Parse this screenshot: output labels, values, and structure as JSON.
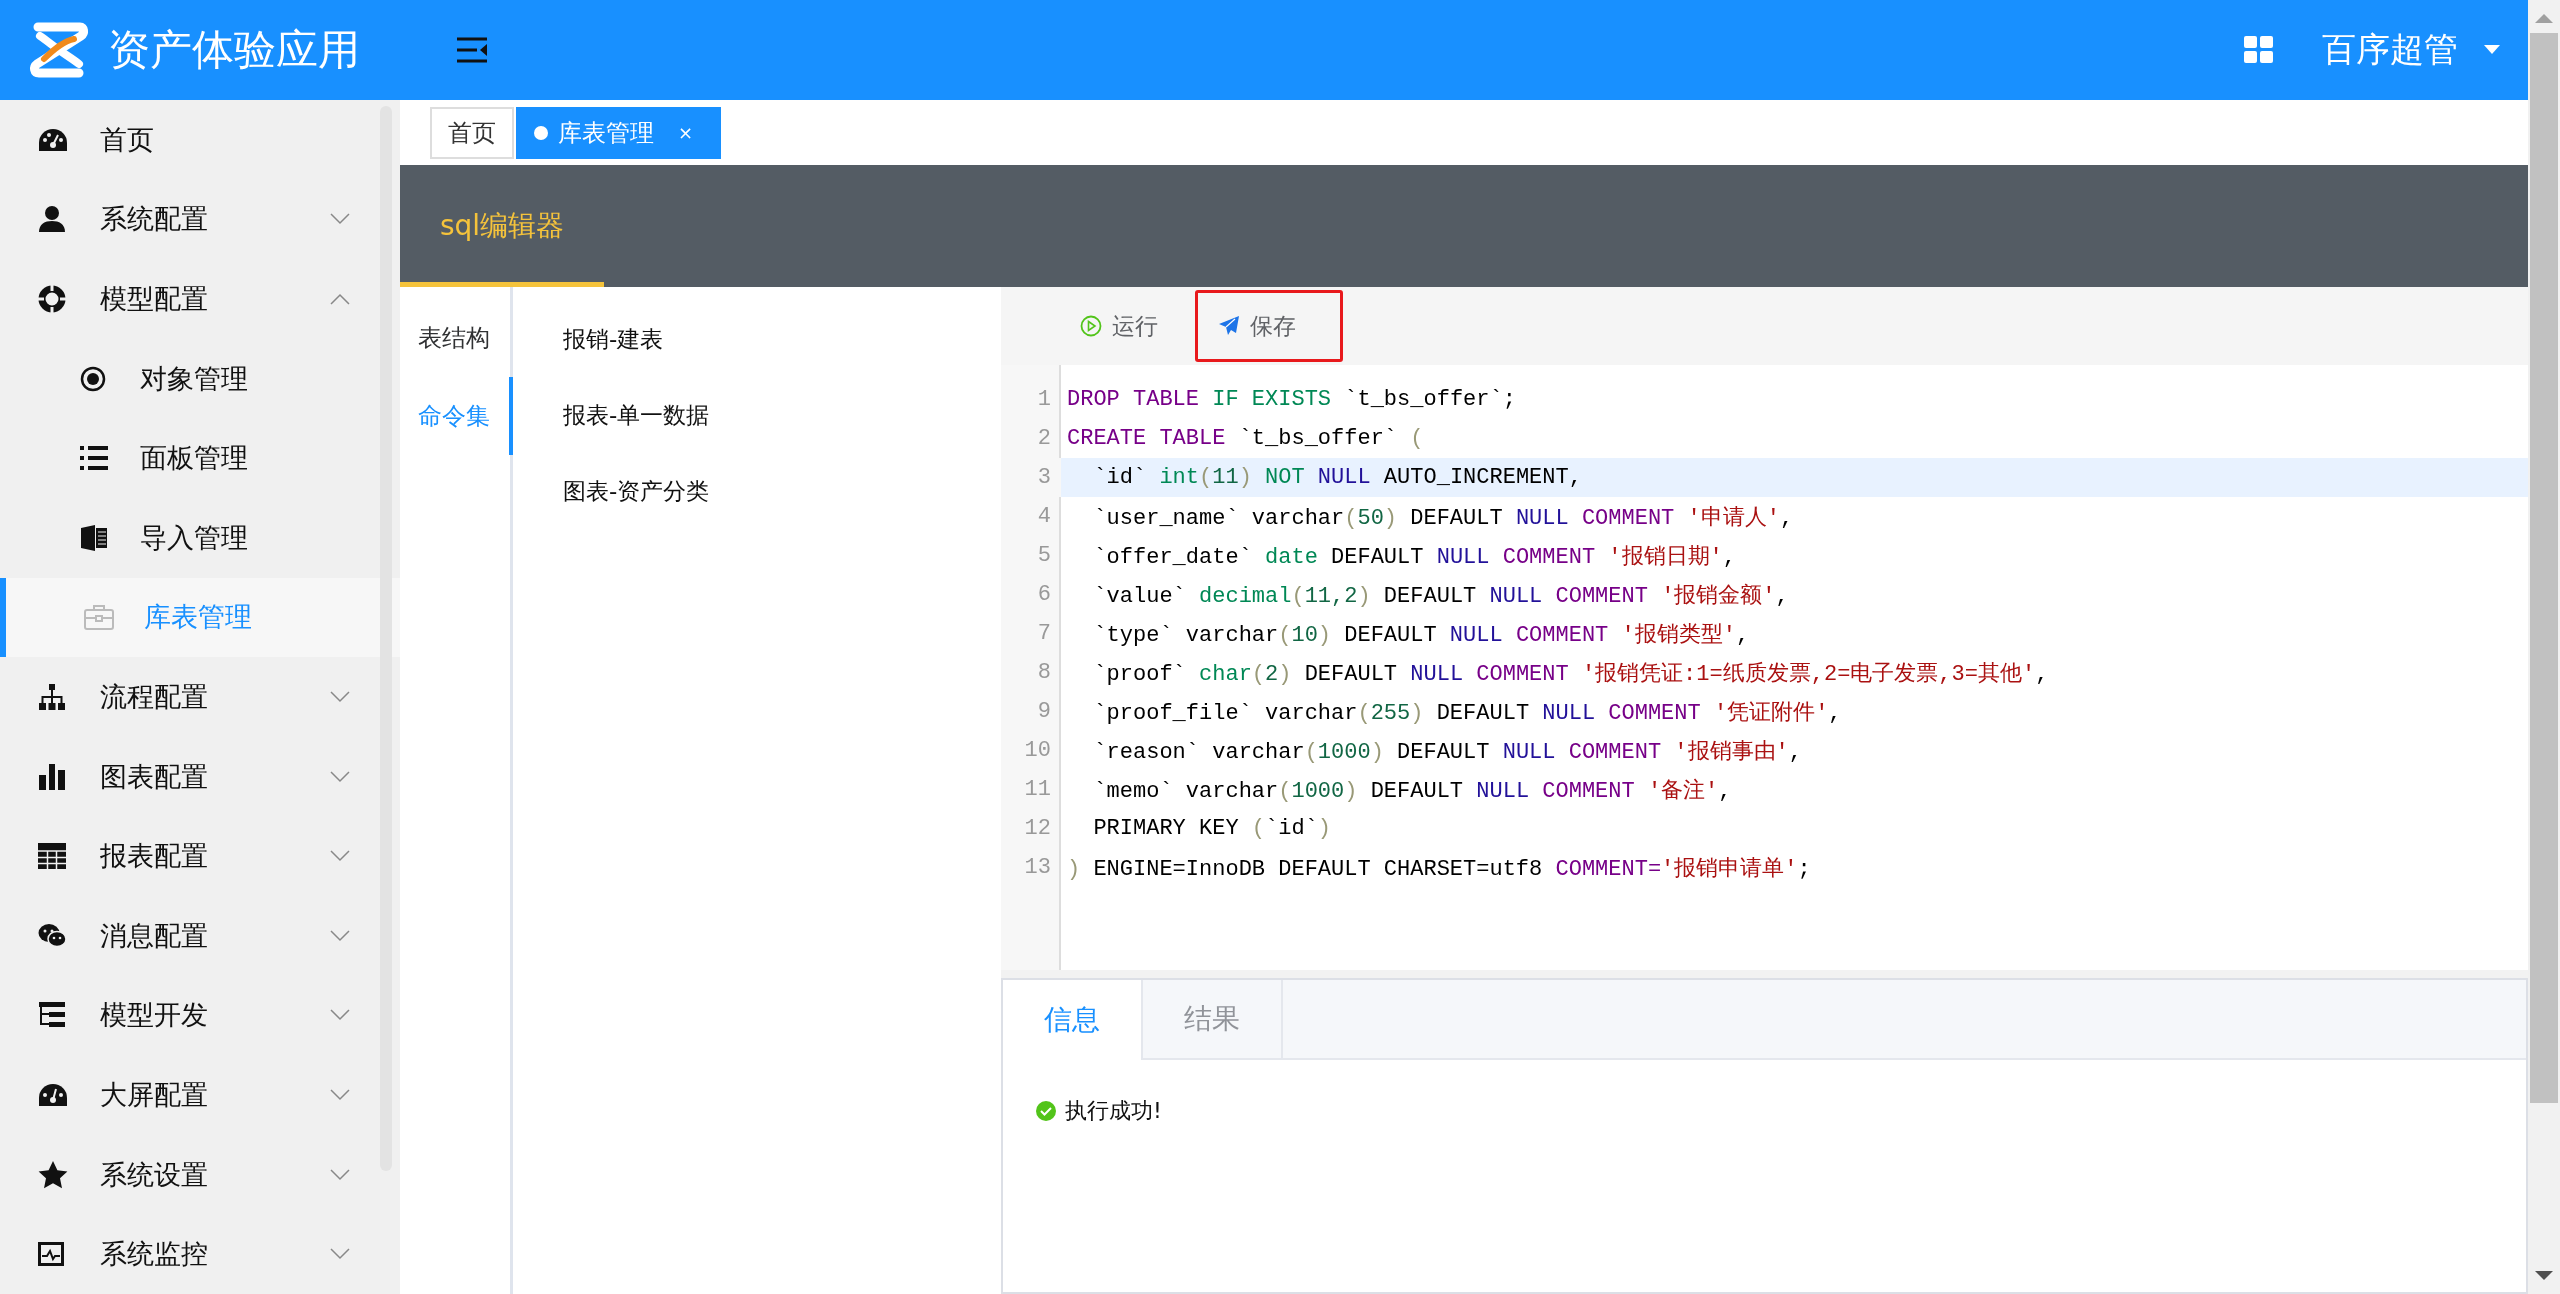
{
  "header": {
    "title": "资产体验应用",
    "user": "百序超管"
  },
  "menu": [
    {
      "label": "首页",
      "selected": false
    },
    {
      "label": "系统配置",
      "selected": false,
      "expanded": false
    },
    {
      "label": "模型配置",
      "selected": false,
      "expanded": true,
      "children": [
        {
          "label": "对象管理",
          "selected": false
        },
        {
          "label": "面板管理",
          "selected": false
        },
        {
          "label": "导入管理",
          "selected": false
        },
        {
          "label": "库表管理",
          "selected": true
        }
      ]
    },
    {
      "label": "流程配置",
      "selected": false,
      "expanded": false
    },
    {
      "label": "图表配置",
      "selected": false,
      "expanded": false
    },
    {
      "label": "报表配置",
      "selected": false,
      "expanded": false
    },
    {
      "label": "消息配置",
      "selected": false,
      "expanded": false
    },
    {
      "label": "模型开发",
      "selected": false,
      "expanded": false
    },
    {
      "label": "大屏配置",
      "selected": false,
      "expanded": false
    },
    {
      "label": "系统设置",
      "selected": false,
      "expanded": false
    },
    {
      "label": "系统监控",
      "selected": false,
      "expanded": false
    }
  ],
  "page_tabs": [
    {
      "label": "首页",
      "selected": false
    },
    {
      "label": "库表管理",
      "selected": true,
      "close": "×"
    }
  ],
  "panel_title": "sql编辑器",
  "side_tabs": [
    {
      "label": "表结构",
      "selected": false
    },
    {
      "label": "命令集",
      "selected": true
    }
  ],
  "commands": [
    "报销-建表",
    "报表-单一数据",
    "图表-资产分类"
  ],
  "toolbar": [
    {
      "label": "运行",
      "highlighted": false
    },
    {
      "label": "保存",
      "highlighted": true
    }
  ],
  "code": [
    {
      "number": "1",
      "active": false,
      "tokens": [
        {
          "kind": "keyword",
          "text": "DROP TABLE"
        },
        {
          "kind": "builtin",
          "text": " IF EXISTS"
        },
        {
          "kind": "plain",
          "text": " `t_bs_offer`;"
        }
      ]
    },
    {
      "number": "2",
      "active": false,
      "tokens": [
        {
          "kind": "keyword",
          "text": "CREATE TABLE"
        },
        {
          "kind": "plain",
          "text": " `t_bs_offer`"
        },
        {
          "kind": "bracket",
          "text": " ("
        }
      ]
    },
    {
      "number": "3",
      "active": true,
      "tokens": [
        {
          "kind": "plain",
          "text": "  `id`"
        },
        {
          "kind": "builtin",
          "text": " int"
        },
        {
          "kind": "bracket",
          "text": "("
        },
        {
          "kind": "number",
          "text": "11"
        },
        {
          "kind": "bracket",
          "text": ")"
        },
        {
          "kind": "builtin",
          "text": " NOT"
        },
        {
          "kind": "atom",
          "text": " NULL"
        },
        {
          "kind": "plain",
          "text": " AUTO_INCREMENT,"
        }
      ]
    },
    {
      "number": "4",
      "active": false,
      "tokens": [
        {
          "kind": "plain",
          "text": "  `user_name` varchar"
        },
        {
          "kind": "bracket",
          "text": "("
        },
        {
          "kind": "number",
          "text": "50"
        },
        {
          "kind": "bracket",
          "text": ")"
        },
        {
          "kind": "plain",
          "text": " DEFAULT"
        },
        {
          "kind": "atom",
          "text": " NULL"
        },
        {
          "kind": "keyword",
          "text": " COMMENT"
        },
        {
          "kind": "string",
          "text": " '申请人'"
        },
        {
          "kind": "plain",
          "text": ","
        }
      ]
    },
    {
      "number": "5",
      "active": false,
      "tokens": [
        {
          "kind": "plain",
          "text": "  `offer_date`"
        },
        {
          "kind": "builtin",
          "text": " date"
        },
        {
          "kind": "plain",
          "text": " DEFAULT"
        },
        {
          "kind": "atom",
          "text": " NULL"
        },
        {
          "kind": "keyword",
          "text": " COMMENT"
        },
        {
          "kind": "string",
          "text": " '报销日期'"
        },
        {
          "kind": "plain",
          "text": ","
        }
      ]
    },
    {
      "number": "6",
      "active": false,
      "tokens": [
        {
          "kind": "plain",
          "text": "  `value`"
        },
        {
          "kind": "builtin",
          "text": " decimal"
        },
        {
          "kind": "bracket",
          "text": "("
        },
        {
          "kind": "number",
          "text": "11,2"
        },
        {
          "kind": "bracket",
          "text": ")"
        },
        {
          "kind": "plain",
          "text": " DEFAULT"
        },
        {
          "kind": "atom",
          "text": " NULL"
        },
        {
          "kind": "keyword",
          "text": " COMMENT"
        },
        {
          "kind": "string",
          "text": " '报销金额'"
        },
        {
          "kind": "plain",
          "text": ","
        }
      ]
    },
    {
      "number": "7",
      "active": false,
      "tokens": [
        {
          "kind": "plain",
          "text": "  `type` varchar"
        },
        {
          "kind": "bracket",
          "text": "("
        },
        {
          "kind": "number",
          "text": "10"
        },
        {
          "kind": "bracket",
          "text": ")"
        },
        {
          "kind": "plain",
          "text": " DEFAULT"
        },
        {
          "kind": "atom",
          "text": " NULL"
        },
        {
          "kind": "keyword",
          "text": " COMMENT"
        },
        {
          "kind": "string",
          "text": " '报销类型'"
        },
        {
          "kind": "plain",
          "text": ","
        }
      ]
    },
    {
      "number": "8",
      "active": false,
      "tokens": [
        {
          "kind": "plain",
          "text": "  `proof`"
        },
        {
          "kind": "builtin",
          "text": " char"
        },
        {
          "kind": "bracket",
          "text": "("
        },
        {
          "kind": "number",
          "text": "2"
        },
        {
          "kind": "bracket",
          "text": ")"
        },
        {
          "kind": "plain",
          "text": " DEFAULT"
        },
        {
          "kind": "atom",
          "text": " NULL"
        },
        {
          "kind": "keyword",
          "text": " COMMENT"
        },
        {
          "kind": "string",
          "text": " '报销凭证:1=纸质发票,2=电子发票,3=其他'"
        },
        {
          "kind": "plain",
          "text": ","
        }
      ]
    },
    {
      "number": "9",
      "active": false,
      "tokens": [
        {
          "kind": "plain",
          "text": "  `proof_file` varchar"
        },
        {
          "kind": "bracket",
          "text": "("
        },
        {
          "kind": "number",
          "text": "255"
        },
        {
          "kind": "bracket",
          "text": ")"
        },
        {
          "kind": "plain",
          "text": " DEFAULT"
        },
        {
          "kind": "atom",
          "text": " NULL"
        },
        {
          "kind": "keyword",
          "text": " COMMENT"
        },
        {
          "kind": "string",
          "text": " '凭证附件'"
        },
        {
          "kind": "plain",
          "text": ","
        }
      ]
    },
    {
      "number": "10",
      "active": false,
      "tokens": [
        {
          "kind": "plain",
          "text": "  `reason` varchar"
        },
        {
          "kind": "bracket",
          "text": "("
        },
        {
          "kind": "number",
          "text": "1000"
        },
        {
          "kind": "bracket",
          "text": ")"
        },
        {
          "kind": "plain",
          "text": " DEFAULT"
        },
        {
          "kind": "atom",
          "text": " NULL"
        },
        {
          "kind": "keyword",
          "text": " COMMENT"
        },
        {
          "kind": "string",
          "text": " '报销事由'"
        },
        {
          "kind": "plain",
          "text": ","
        }
      ]
    },
    {
      "number": "11",
      "active": false,
      "tokens": [
        {
          "kind": "plain",
          "text": "  `memo` varchar"
        },
        {
          "kind": "bracket",
          "text": "("
        },
        {
          "kind": "number",
          "text": "1000"
        },
        {
          "kind": "bracket",
          "text": ")"
        },
        {
          "kind": "plain",
          "text": " DEFAULT"
        },
        {
          "kind": "atom",
          "text": " NULL"
        },
        {
          "kind": "keyword",
          "text": " COMMENT"
        },
        {
          "kind": "string",
          "text": " '备注'"
        },
        {
          "kind": "plain",
          "text": ","
        }
      ]
    },
    {
      "number": "12",
      "active": false,
      "tokens": [
        {
          "kind": "plain",
          "text": "  PRIMARY KEY"
        },
        {
          "kind": "bracket",
          "text": " ("
        },
        {
          "kind": "plain",
          "text": "`id`"
        },
        {
          "kind": "bracket",
          "text": ")"
        }
      ]
    },
    {
      "number": "13",
      "active": false,
      "tokens": [
        {
          "kind": "bracket",
          "text": ")"
        },
        {
          "kind": "plain",
          "text": " ENGINE=InnoDB DEFAULT CHARSET=utf8"
        },
        {
          "kind": "keyword",
          "text": " COMMENT="
        },
        {
          "kind": "string",
          "text": "'报销申请单'"
        },
        {
          "kind": "plain",
          "text": ";"
        }
      ]
    }
  ],
  "result_tabs": [
    {
      "label": "信息",
      "selected": true
    },
    {
      "label": "结果",
      "selected": false
    }
  ],
  "message": {
    "kind": "success",
    "text": "执行成功!"
  }
}
